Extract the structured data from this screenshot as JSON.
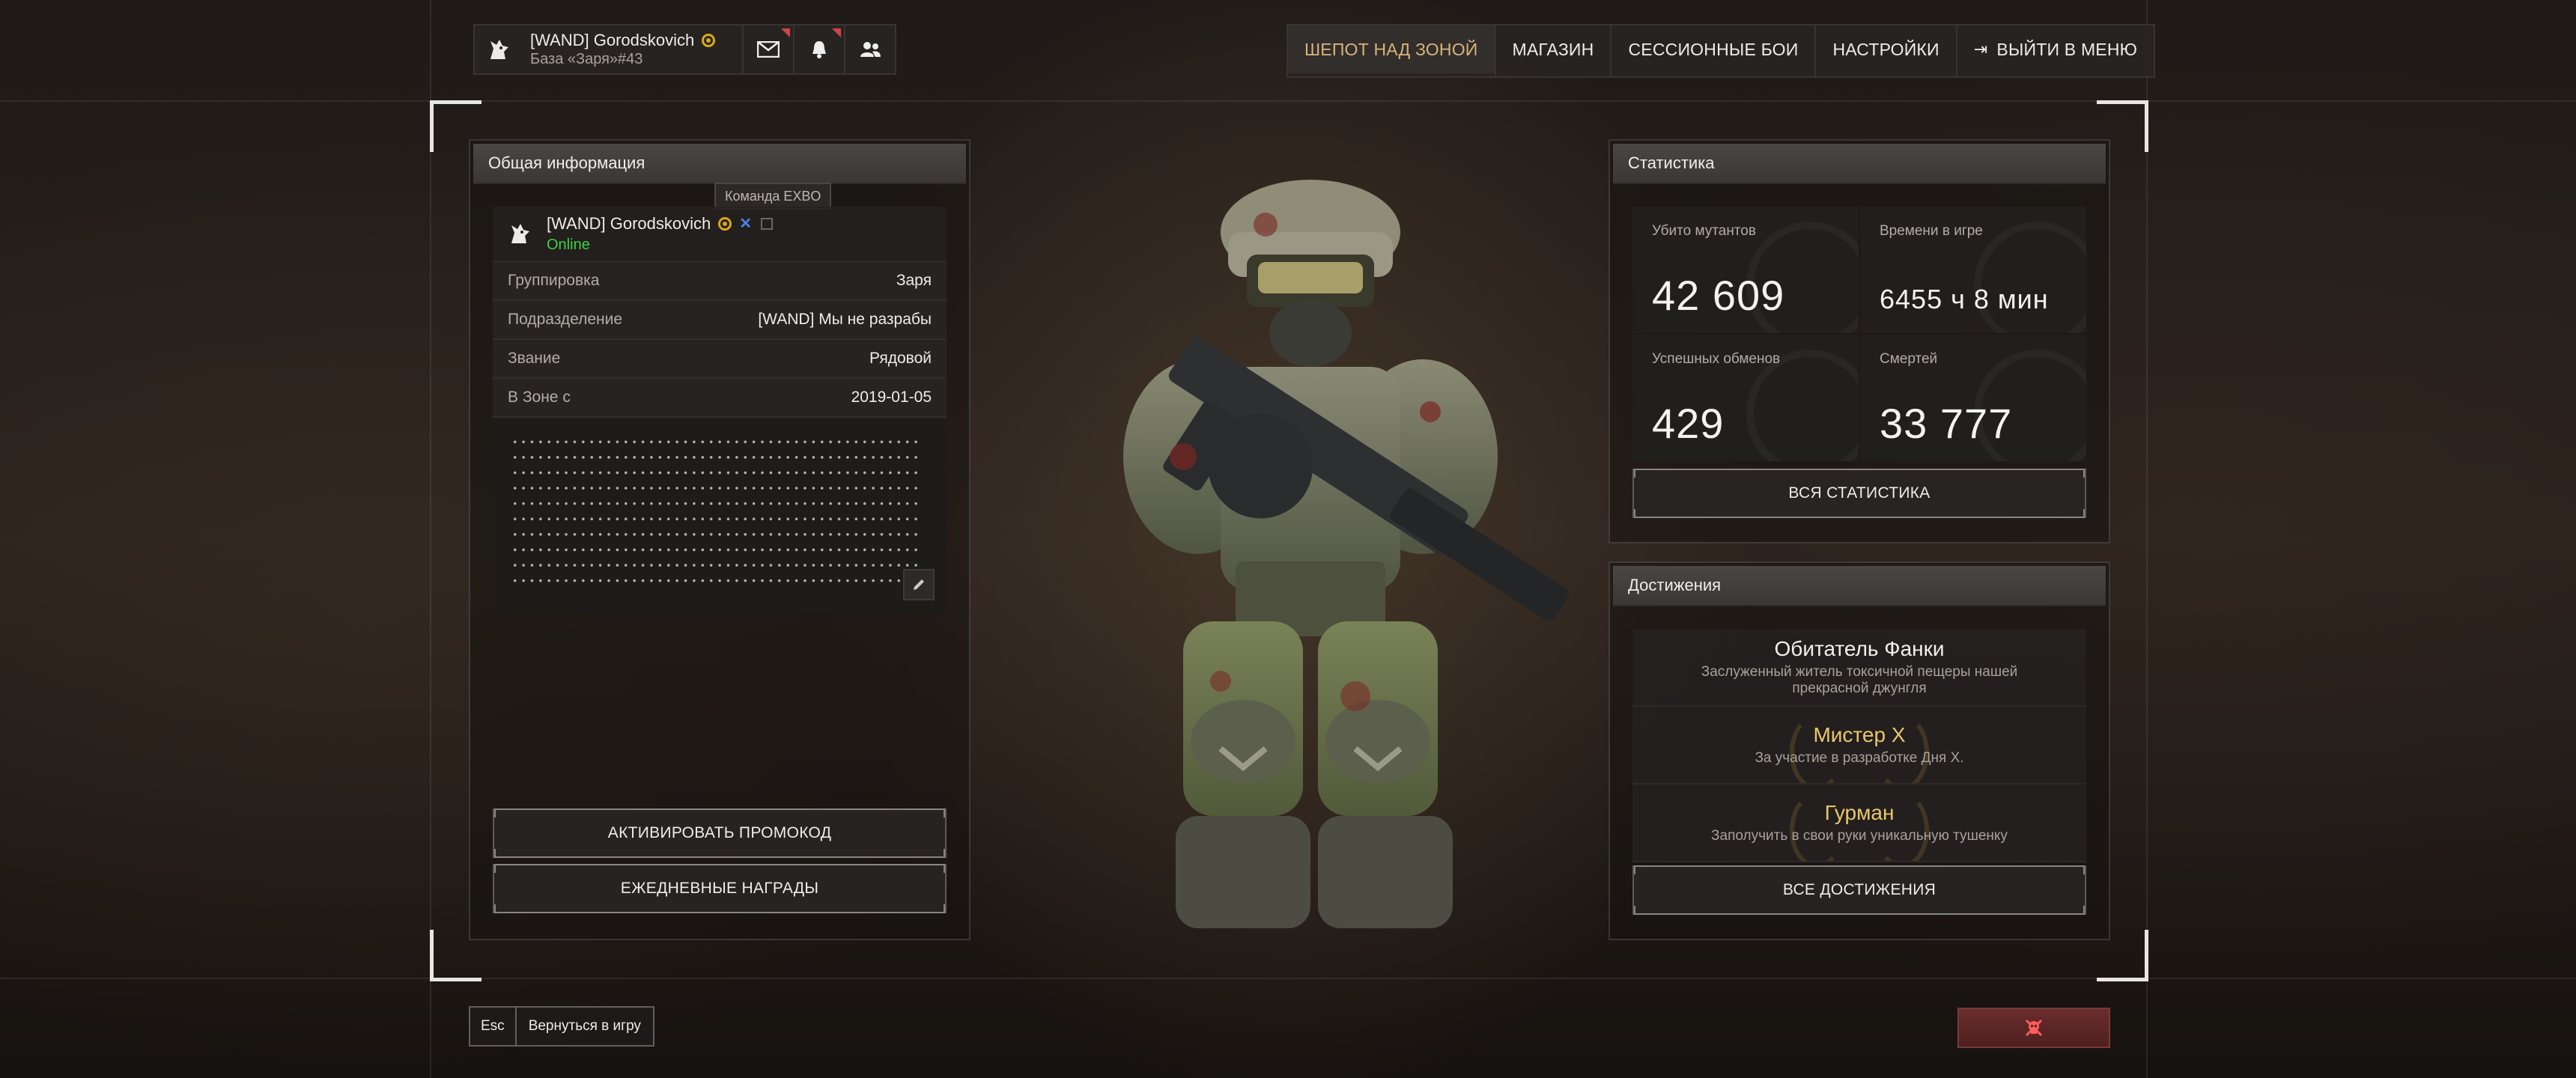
{
  "user": {
    "name": "[WAND] Gorodskovich",
    "base": "База «Заря»#43"
  },
  "topbar": {
    "icons": [
      "mail-icon",
      "bell-icon",
      "friends-icon"
    ]
  },
  "nav": {
    "items": [
      "ШЕПОТ НАД ЗОНОЙ",
      "МАГАЗИН",
      "СЕССИОННЫЕ БОИ",
      "НАСТРОЙКИ"
    ],
    "exit": "ВЫЙТИ В МЕНЮ",
    "active_color": "#d8b37a"
  },
  "general": {
    "title": "Общая информация",
    "team_tooltip": "Команда EXBO",
    "profile": {
      "name": "[WAND] Gorodskovich",
      "status": "Online",
      "status_color": "#3fcf3f"
    },
    "rows": [
      {
        "label": "Группировка",
        "value": "Заря"
      },
      {
        "label": "Подразделение",
        "value": "[WAND] Мы не разрабы"
      },
      {
        "label": "Звание",
        "value": "Рядовой"
      },
      {
        "label": "В Зоне с",
        "value": "2019-01-05"
      }
    ],
    "promo_button": "АКТИВИРОВАТЬ ПРОМОКОД",
    "daily_button": "ЕЖЕДНЕВНЫЕ НАГРАДЫ"
  },
  "stats": {
    "title": "Статистика",
    "cells": [
      {
        "label": "Убито мутантов",
        "value": "42 609"
      },
      {
        "label": "Времени в игре",
        "value": "6455 ч 8 мин"
      },
      {
        "label": "Успешных обменов",
        "value": "429"
      },
      {
        "label": "Смертей",
        "value": "33 777"
      }
    ],
    "all_button": "ВСЯ СТАТИСТИКА"
  },
  "achievements": {
    "title": "Достижения",
    "items": [
      {
        "title": "Обитатель Фанки",
        "desc": "Заслуженный житель токсичной пещеры нашей прекрасной джунгля"
      },
      {
        "title": "Мистер X",
        "desc": "За участие в разработке Дня X."
      },
      {
        "title": "Гурман",
        "desc": "Заполучить в свои руки уникальную тушенку"
      }
    ],
    "gold_color": "#e8c66b",
    "all_button": "ВСЕ ДОСТИЖЕНИЯ"
  },
  "bottom": {
    "esc_key": "Esc",
    "return_label": "Вернуться в игру",
    "danger_icon": "skull-icon"
  }
}
